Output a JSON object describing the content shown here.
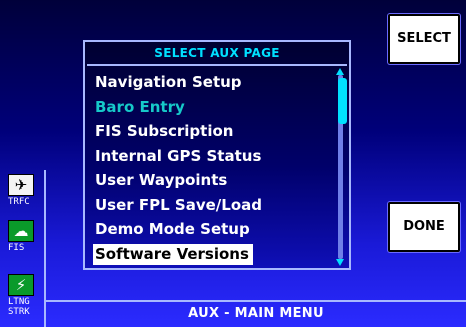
{
  "panel": {
    "title": "SELECT AUX PAGE",
    "items": [
      {
        "label": "Navigation Setup",
        "state": "normal"
      },
      {
        "label": "Baro Entry",
        "state": "disabled"
      },
      {
        "label": "FIS Subscription",
        "state": "normal"
      },
      {
        "label": "Internal GPS Status",
        "state": "normal"
      },
      {
        "label": "User Waypoints",
        "state": "normal"
      },
      {
        "label": "User FPL Save/Load",
        "state": "normal"
      },
      {
        "label": "Demo Mode Setup",
        "state": "normal"
      },
      {
        "label": "Software Versions",
        "state": "selected"
      }
    ]
  },
  "buttons": {
    "select_label": "SELECT",
    "done_label": "DONE"
  },
  "side": {
    "trfc": {
      "label": "TRFC",
      "icon": "airplane-icon"
    },
    "fis": {
      "label": "FIS",
      "icon": "weather-icon"
    },
    "ltng": {
      "label": "LTNG STRK",
      "icon": "lightning-icon"
    }
  },
  "status": {
    "text": "AUX - MAIN MENU"
  },
  "colors": {
    "accent": "#00e0ff",
    "disabled_item": "#16c9c9",
    "border": "#a8b8ff"
  }
}
